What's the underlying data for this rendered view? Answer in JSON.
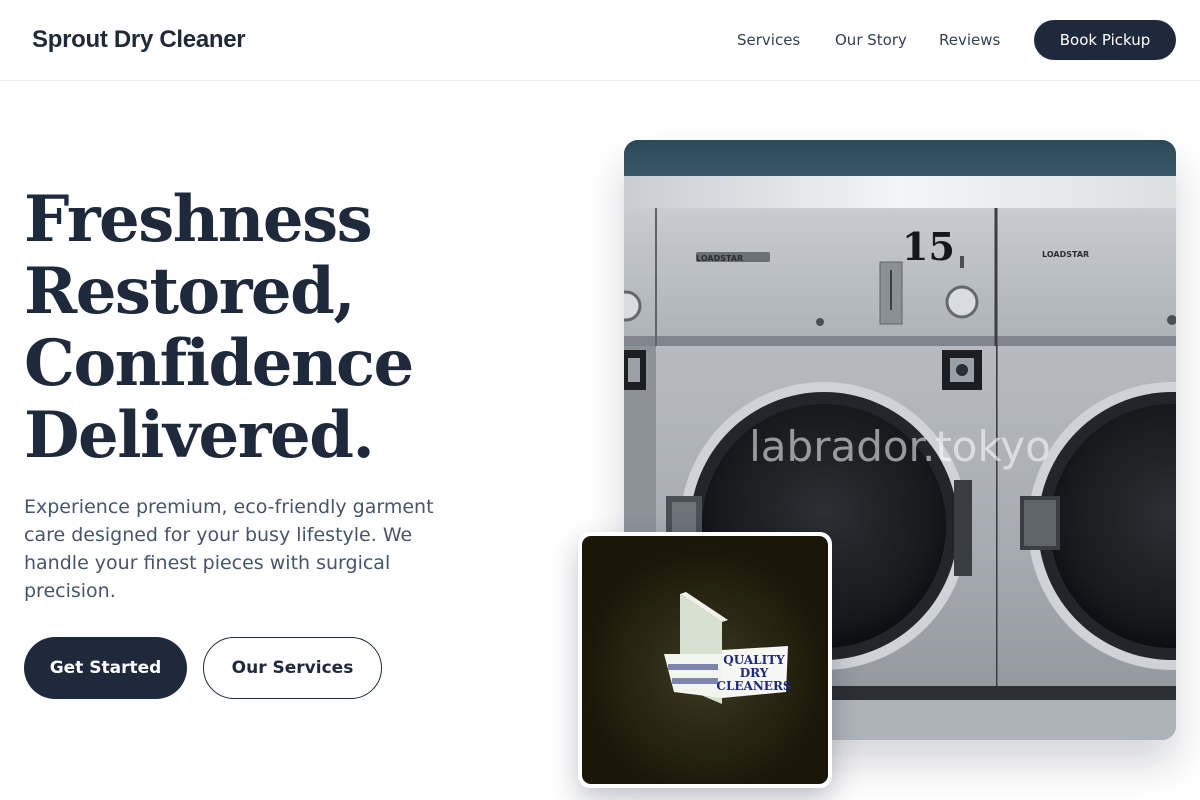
{
  "header": {
    "brand": "Sprout Dry Cleaner",
    "nav": [
      "Services",
      "Our Story",
      "Reviews"
    ],
    "cta_label": "Book Pickup"
  },
  "hero": {
    "headline_lines": [
      "Freshness",
      "Restored,",
      "Confidence",
      "Delivered."
    ],
    "subcopy": "Experience premium, eco-friendly garment care designed for your busy lifestyle. We handle your finest pieces with surgical precision.",
    "primary_button": "Get Started",
    "secondary_button": "Our Services"
  },
  "main_photo": {
    "machine_number": "15",
    "brand_plate_left": "LOADSTAR",
    "brand_plate_right": "LOADSTAR",
    "watermark": "labrador.tokyo"
  },
  "inset_photo": {
    "sign_lines": [
      "QUALITY",
      "DRY",
      "CLEANERS"
    ]
  },
  "colors": {
    "primary": "#1e293b",
    "text_muted": "#475569",
    "background": "#ffffff"
  }
}
